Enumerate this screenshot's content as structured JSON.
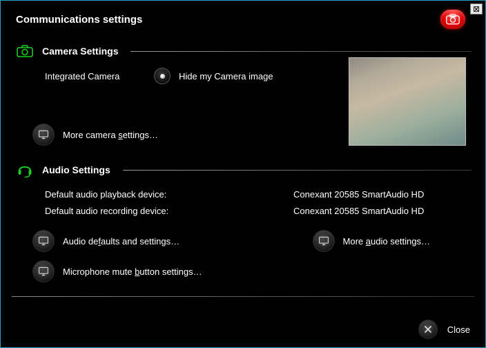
{
  "window": {
    "title": "Communications settings",
    "close_x": "✕"
  },
  "camera": {
    "section_title": "Camera Settings",
    "device_label": "Integrated Camera",
    "hide_label": "Hide my Camera image",
    "more_link_prefix": "More camera ",
    "more_link_u": "s",
    "more_link_suffix": "ettings…"
  },
  "audio": {
    "section_title": "Audio Settings",
    "playback_label": "Default audio playback device:",
    "playback_value": "Conexant 20585 SmartAudio HD",
    "recording_label": "Default audio recording device:",
    "recording_value": "Conexant 20585 SmartAudio HD",
    "defaults_link_prefix": "Audio de",
    "defaults_link_u": "f",
    "defaults_link_suffix": "aults and settings…",
    "more_link_prefix": "More ",
    "more_link_u": "a",
    "more_link_suffix": "udio settings…",
    "mic_link_prefix": "Microphone mute ",
    "mic_link_u": "b",
    "mic_link_suffix": "utton settings…"
  },
  "footer": {
    "close_label": "Close"
  }
}
